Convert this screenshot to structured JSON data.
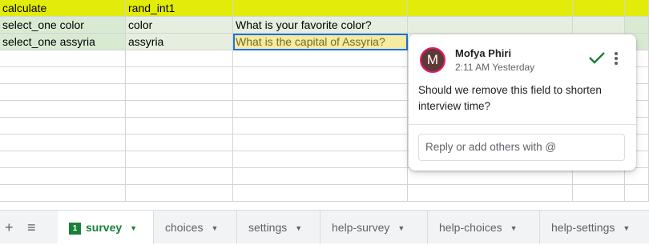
{
  "sheet": {
    "rows": [
      [
        "calculate",
        "rand_int1",
        "",
        "",
        "",
        ""
      ],
      [
        "select_one color",
        "color",
        "What is your favorite color?",
        "",
        "",
        ""
      ],
      [
        "select_one assyria",
        "assyria",
        "What is the capital of Assyria?",
        "",
        "",
        ""
      ]
    ],
    "colors": {
      "header_row": "#e3eb0a",
      "light_green": "#d9ead3",
      "selection": "#1a73e8"
    }
  },
  "comment": {
    "avatar_initial": "M",
    "author": "Mofya Phiri",
    "time": "2:11 AM Yesterday",
    "text": "Should we remove this field to shorten interview time?",
    "reply_placeholder": "Reply or add others with @",
    "resolve_icon": "check-icon",
    "more_icon": "more-vert-icon"
  },
  "tabs": {
    "add_icon": "+",
    "list_icon": "≡",
    "items": [
      {
        "label": "survey",
        "badge": "1",
        "active": true
      },
      {
        "label": "choices"
      },
      {
        "label": "settings"
      },
      {
        "label": "help-survey"
      },
      {
        "label": "help-choices"
      },
      {
        "label": "help-settings"
      }
    ]
  }
}
